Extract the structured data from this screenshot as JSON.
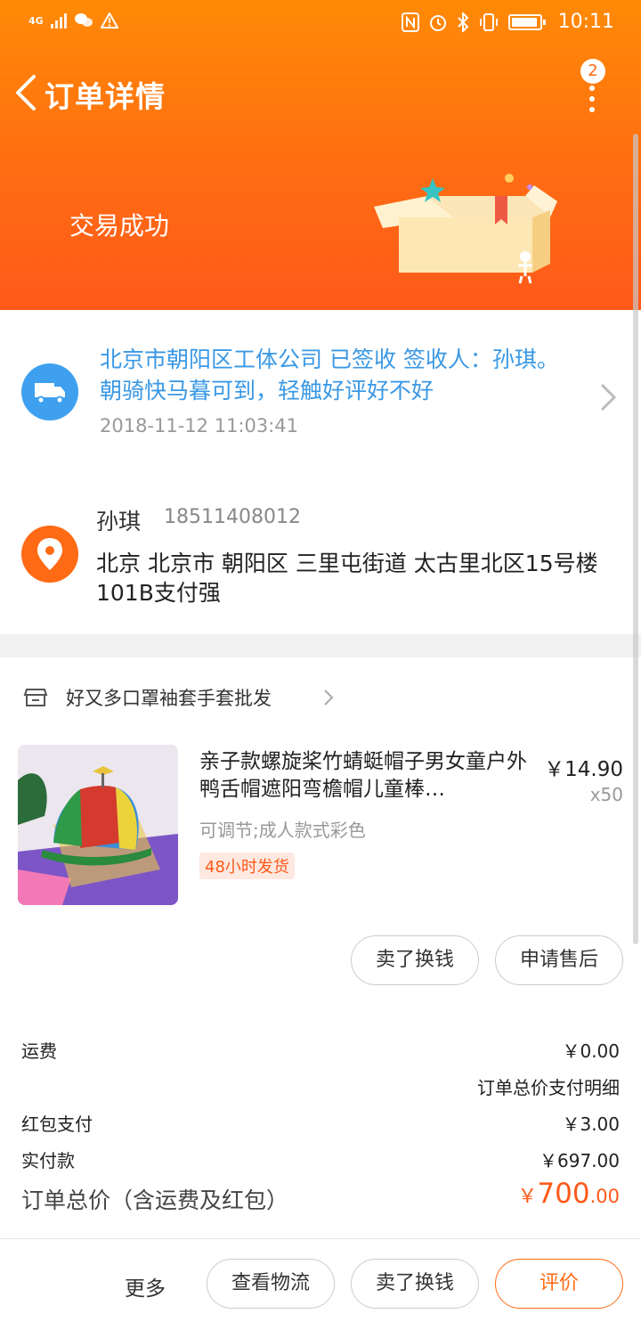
{
  "status_bar": {
    "network": "4G",
    "time": "10:11"
  },
  "nav": {
    "title": "订单详情",
    "badge_count": "2"
  },
  "order_status": "交易成功",
  "logistics": {
    "text": "北京市朝阳区工体公司 已签收 签收人：孙琪。朝骑快马暮可到，轻触好评好不好",
    "time": "2018-11-12 11:03:41"
  },
  "address": {
    "name": "孙琪",
    "phone": "18511408012",
    "detail": "北京 北京市 朝阳区 三里屯街道 太古里北区15号楼101B支付强"
  },
  "shop": {
    "name": "好又多口罩袖套手套批发"
  },
  "product": {
    "title": "亲子款螺旋桨竹蜻蜓帽子男女童户外鸭舌帽遮阳弯檐帽儿童棒…",
    "price": "￥14.90",
    "qty": "x50",
    "spec": "可调节;成人款式彩色",
    "tag": "48小时发货"
  },
  "item_actions": {
    "sell_label": "卖了换钱",
    "after_sale_label": "申请售后"
  },
  "fees": {
    "shipping_label": "运费",
    "shipping_value": "￥0.00",
    "detail_link": "订单总价支付明细",
    "redpacket_label": "红包支付",
    "redpacket_value": "￥3.00",
    "paid_label": "实付款",
    "paid_value": "￥697.00"
  },
  "total": {
    "label": "订单总价（含运费及红包）",
    "symbol": "￥",
    "integer": "700",
    "decimal": ".00"
  },
  "bottom_bar": {
    "more_label": "更多",
    "logistics_label": "查看物流",
    "sell_label": "卖了换钱",
    "review_label": "评价"
  },
  "colors": {
    "accent": "#ff6a14",
    "link_blue": "#3a98e5"
  }
}
